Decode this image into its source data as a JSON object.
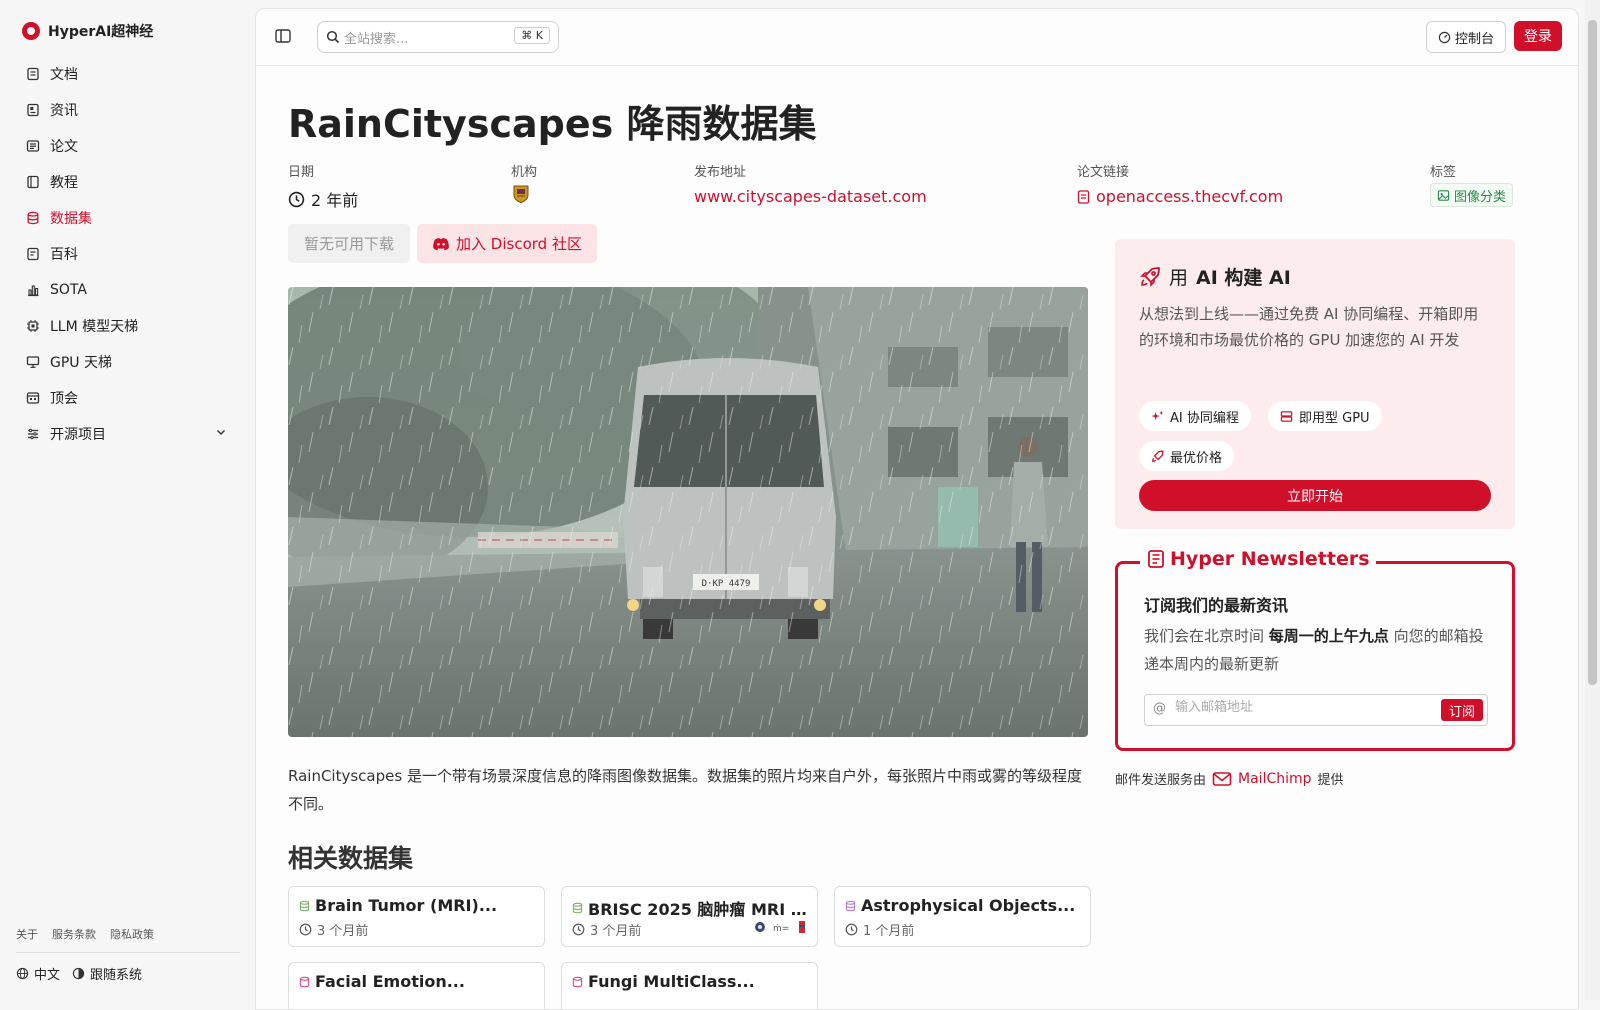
{
  "brand": {
    "name": "HyperAI超神经"
  },
  "sidebar": {
    "items": [
      {
        "label": "文档",
        "icon": "document-icon"
      },
      {
        "label": "资讯",
        "icon": "news-icon"
      },
      {
        "label": "论文",
        "icon": "paper-icon"
      },
      {
        "label": "教程",
        "icon": "tutorial-icon"
      },
      {
        "label": "数据集",
        "icon": "database-icon",
        "active": true
      },
      {
        "label": "百科",
        "icon": "wiki-icon"
      },
      {
        "label": "SOTA",
        "icon": "chart-icon"
      },
      {
        "label": "LLM 模型天梯",
        "icon": "cpu-icon"
      },
      {
        "label": "GPU 天梯",
        "icon": "monitor-icon"
      },
      {
        "label": "顶会",
        "icon": "conference-icon"
      },
      {
        "label": "开源项目",
        "icon": "list-icon"
      }
    ],
    "footer_links": [
      "关于",
      "服务条款",
      "隐私政策"
    ],
    "language": "中文",
    "theme": "跟随系统"
  },
  "header": {
    "search_placeholder": "全站搜索...",
    "shortcut": "K",
    "console_label": "控制台",
    "login_label": "登录"
  },
  "page": {
    "title": "RainCityscapes 降雨数据集",
    "meta": {
      "date_label": "日期",
      "date_value": "2 年前",
      "org_label": "机构",
      "release_label": "发布地址",
      "release_value": "www.cityscapes-dataset.com",
      "paper_label": "论文链接",
      "paper_value": "openaccess.thecvf.com",
      "tags_label": "标签",
      "tag_value": "图像分类"
    },
    "download_label": "暂无可用下载",
    "discord_label": "加入 Discord 社区",
    "description": "RainCityscapes 是一个带有场景深度信息的降雨图像数据集。数据集的照片均来自户外，每张照片中雨或雾的等级程度不同。",
    "related_title": "相关数据集",
    "related": [
      {
        "title": "Brain Tumor (MRI)...",
        "date": "3 个月前"
      },
      {
        "title": "BRISC 2025 脑肿瘤 MRI ...",
        "date": "3 个月前"
      },
      {
        "title": "Astrophysical Objects...",
        "date": "1 个月前"
      },
      {
        "title": "Facial Emotion..."
      },
      {
        "title": "Fungi MultiClass..."
      }
    ]
  },
  "promo": {
    "title_prefix": "用",
    "title_bold": "AI 构建 AI",
    "description": "从想法到上线——通过免费 AI 协同编程、开箱即用的环境和市场最优价格的 GPU 加速您的 AI 开发",
    "chips": [
      "AI 协同编程",
      "即用型 GPU",
      "最优价格"
    ],
    "cta": "立即开始"
  },
  "newsletter": {
    "legend": "Hyper Newsletters",
    "heading": "订阅我们的最新资讯",
    "text_pre": "我们会在北京时间",
    "text_bold": "每周一的上午九点",
    "text_post": "向您的邮箱投递本周内的最新更新",
    "placeholder": "输入邮箱地址",
    "subscribe": "订阅",
    "provider_pre": "邮件发送服务由",
    "provider": "MailChimp",
    "provider_post": "提供"
  },
  "colors": {
    "accent": "#d0102a",
    "tag_green": "#2a8a4a"
  }
}
